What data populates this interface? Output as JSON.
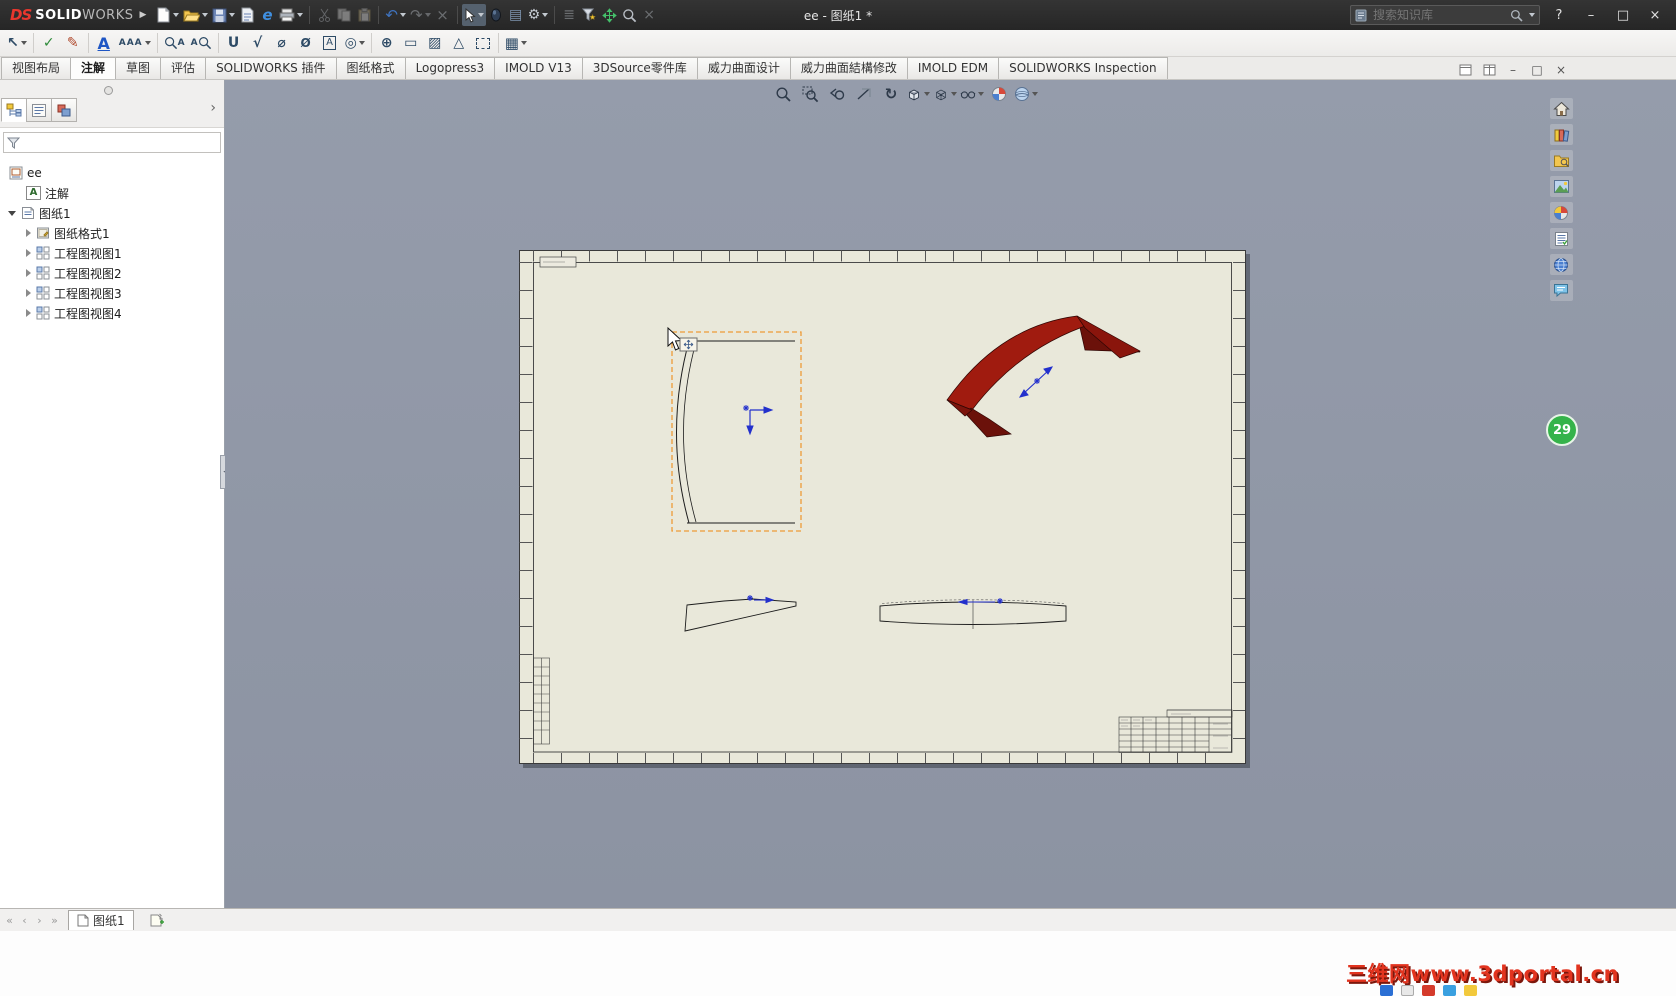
{
  "titlebar": {
    "logo_ds": "DS",
    "logo_solid": "SOLID",
    "logo_works": "WORKS",
    "expand_arrow": "▶",
    "title": "ee - 图纸1 *",
    "search_placeholder": "搜索知识库",
    "help": "?"
  },
  "window_controls": {
    "minimize": "–",
    "maximize": "□",
    "close": "×"
  },
  "doc_controls": {
    "minimize": "–",
    "restore": "□",
    "close": "×"
  },
  "icon_glyphs": {
    "web": "e",
    "undo": "↶",
    "redo": "↷",
    "delete": "×",
    "report": "▤",
    "gear": "⚙",
    "menu": "≣",
    "clear": "×",
    "chevron": "›",
    "rotate": "↻",
    "annotation_a": "A"
  },
  "toolbar_main": {
    "icons": [
      "new-document",
      "open",
      "save",
      "make-drawing",
      "web-browser",
      "print",
      "cut",
      "copy",
      "paste",
      "undo",
      "redo",
      "delete",
      "select",
      "view-settings",
      "report-table",
      "options",
      "toolbars",
      "selection-filter",
      "pan",
      "zoom",
      "clear"
    ]
  },
  "toolbar_annotation": {
    "icons": [
      "leader",
      "spell-check",
      "format-painter",
      "note",
      "linear-note-pattern",
      "zoom-to-note",
      "find-note",
      "weld-symbol",
      "surface-finish",
      "hole-callout",
      "cosmetic-thread",
      "datum-feature",
      "datum-target",
      "geometric-tolerance",
      "block",
      "area-hatch",
      "weld-triangle",
      "revision-cloud",
      "table"
    ],
    "glyphs": [
      "↖",
      "✓",
      "✎",
      "A",
      "AAA",
      "A",
      "A",
      "U",
      "√",
      "⌀",
      "Ø",
      "A",
      "◎",
      "⊕",
      "▭",
      "▨",
      "△",
      "☁",
      "▦"
    ]
  },
  "ribbon_tabs": {
    "active_index": 1,
    "items": [
      {
        "label": "视图布局"
      },
      {
        "label": "注解"
      },
      {
        "label": "草图"
      },
      {
        "label": "评估"
      },
      {
        "label": "SOLIDWORKS 插件"
      },
      {
        "label": "图纸格式"
      },
      {
        "label": "Logopress3"
      },
      {
        "label": "IMOLD V13"
      },
      {
        "label": "3DSource零件库"
      },
      {
        "label": "威力曲面设计"
      },
      {
        "label": "威力曲面結構修改"
      },
      {
        "label": "IMOLD EDM"
      },
      {
        "label": "SOLIDWORKS Inspection"
      }
    ]
  },
  "left_panel": {
    "tabs": [
      "featuremanager-tab",
      "propertymanager-tab",
      "configurationmanager-tab"
    ],
    "tree": {
      "root": "ee",
      "items": [
        {
          "label": "注解"
        },
        {
          "label": "图纸1"
        },
        {
          "label": "图纸格式1"
        },
        {
          "label": "工程图视图1"
        },
        {
          "label": "工程图视图2"
        },
        {
          "label": "工程图视图3"
        },
        {
          "label": "工程图视图4"
        }
      ]
    }
  },
  "headsup_toolbar": {
    "icons": [
      "zoom-fit",
      "zoom-area",
      "previous-view",
      "section-view",
      "rotate-view",
      "view-orientation",
      "display-style",
      "hide-show-items",
      "edit-appearance",
      "apply-scene"
    ]
  },
  "task_pane": {
    "icons": [
      "solidworks-resources",
      "design-library",
      "file-explorer",
      "view-palette",
      "appearances-scenes",
      "custom-properties",
      "solidworks-forum",
      "user-community"
    ]
  },
  "sheet_bar": {
    "nav": [
      "«",
      "‹",
      "›",
      "»"
    ],
    "tabs": [
      {
        "label": "图纸1"
      }
    ]
  },
  "chat_badge": {
    "value": "29"
  },
  "watermark": {
    "text": "三维网www.3dportal.cn"
  }
}
